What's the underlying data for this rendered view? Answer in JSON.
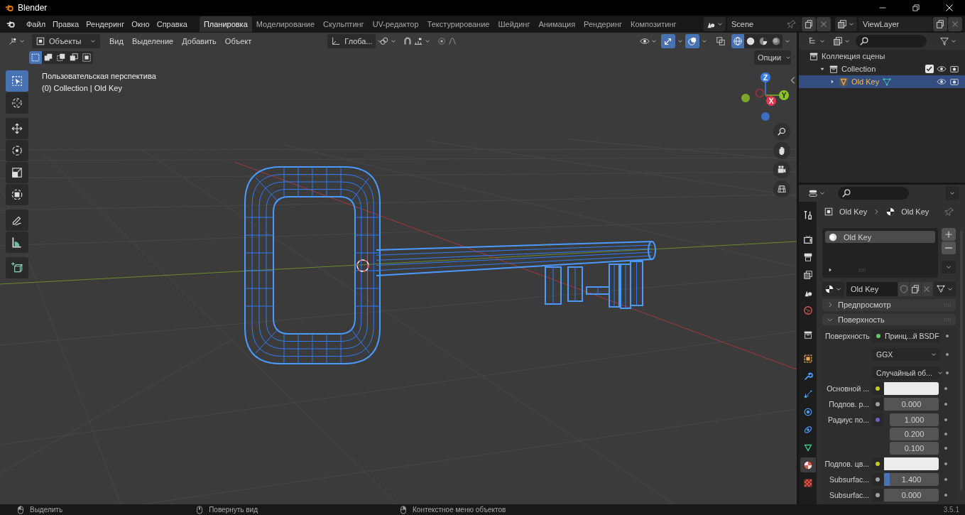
{
  "window": {
    "title": "Blender"
  },
  "menu": [
    "Файл",
    "Правка",
    "Рендеринг",
    "Окно",
    "Справка"
  ],
  "workspaces": [
    {
      "label": "Планировка",
      "selected": true
    },
    {
      "label": "Моделирование",
      "selected": false
    },
    {
      "label": "Скульптинг",
      "selected": false
    },
    {
      "label": "UV-редактор",
      "selected": false
    },
    {
      "label": "Текстурирование",
      "selected": false
    },
    {
      "label": "Шейдинг",
      "selected": false
    },
    {
      "label": "Анимация",
      "selected": false
    },
    {
      "label": "Рендеринг",
      "selected": false
    },
    {
      "label": "Композитинг",
      "selected": false
    }
  ],
  "scene": {
    "name": "Scene"
  },
  "view_layer": {
    "name": "ViewLayer"
  },
  "viewport": {
    "mode": "Объекты",
    "menus": [
      "Вид",
      "Выделение",
      "Добавить",
      "Объект"
    ],
    "orientation": "Глоба...",
    "options": "Опции",
    "select_modes": [
      {
        "selected": true
      },
      {
        "selected": false
      },
      {
        "selected": false
      },
      {
        "selected": false
      },
      {
        "selected": false
      }
    ],
    "gizmos_on": true,
    "overlays_on": true,
    "shading": [
      {
        "selected": true
      },
      {
        "selected": false
      },
      {
        "selected": false
      },
      {
        "selected": false
      }
    ],
    "view_name": "Пользовательская перспектива",
    "object_info": "(0) Collection | Old Key",
    "tools": [
      {
        "selected": true
      },
      {
        "selected": false
      },
      {
        "selected": false
      },
      {
        "selected": false
      },
      {
        "selected": false
      },
      {
        "selected": false
      },
      {
        "selected": false
      },
      {
        "selected": false
      },
      {
        "selected": false
      }
    ],
    "axes": [
      "Z",
      "Y",
      "X"
    ]
  },
  "outliner": {
    "items": [
      {
        "label": "Коллекция сцены",
        "kind": "scene",
        "children": [
          {
            "label": "Collection",
            "kind": "collection",
            "expanded": true,
            "selected": false,
            "checked": true,
            "children": [
              {
                "label": "Old Key",
                "kind": "object",
                "expanded": false,
                "selected": true
              }
            ]
          }
        ]
      }
    ]
  },
  "properties": {
    "tabs": [
      {
        "selected": false
      },
      {
        "selected": false
      },
      {
        "selected": false
      },
      {
        "selected": false
      },
      {
        "selected": false
      },
      {
        "selected": false
      },
      {
        "selected": false
      },
      {
        "selected": false
      },
      {
        "selected": false
      },
      {
        "selected": false
      },
      {
        "selected": false
      },
      {
        "selected": false
      },
      {
        "selected": false
      },
      {
        "selected": true
      },
      {
        "selected": false
      }
    ],
    "breadcrumb": [
      "Old Key",
      "Old Key"
    ],
    "slots": [
      {
        "label": "Old Key",
        "selected": true
      }
    ],
    "material": "Old Key",
    "panels": [
      {
        "title": "Предпросмотр",
        "expanded": false
      },
      {
        "title": "Поверхность",
        "expanded": true
      }
    ],
    "rows": [
      {
        "kind": "shader",
        "label": "Поверхность",
        "value": "Принц...й BSDF"
      },
      {
        "kind": "dropdown",
        "value": "GGX"
      },
      {
        "kind": "dropdown",
        "value": "Случайный об..."
      },
      {
        "kind": "color",
        "label": "Основной ...",
        "color": "#ececec"
      },
      {
        "kind": "value",
        "label": "Подпов. р...",
        "value": "0.000"
      },
      {
        "kind": "vector",
        "label": "Радиус по...",
        "values": [
          "1.000",
          "0.200",
          "0.100"
        ]
      },
      {
        "kind": "color",
        "label": "Подпов. цв...",
        "color": "#ececec"
      },
      {
        "kind": "slider",
        "label": "Subsurfac...",
        "value": "1.400",
        "level": 0.1
      },
      {
        "kind": "value",
        "label": "Subsurfac...",
        "value": "0.000"
      }
    ]
  },
  "status_bar": {
    "hints": [
      "Выделить",
      "Повернуть вид",
      "Контекстное меню объектов"
    ],
    "version": "3.5.1"
  }
}
